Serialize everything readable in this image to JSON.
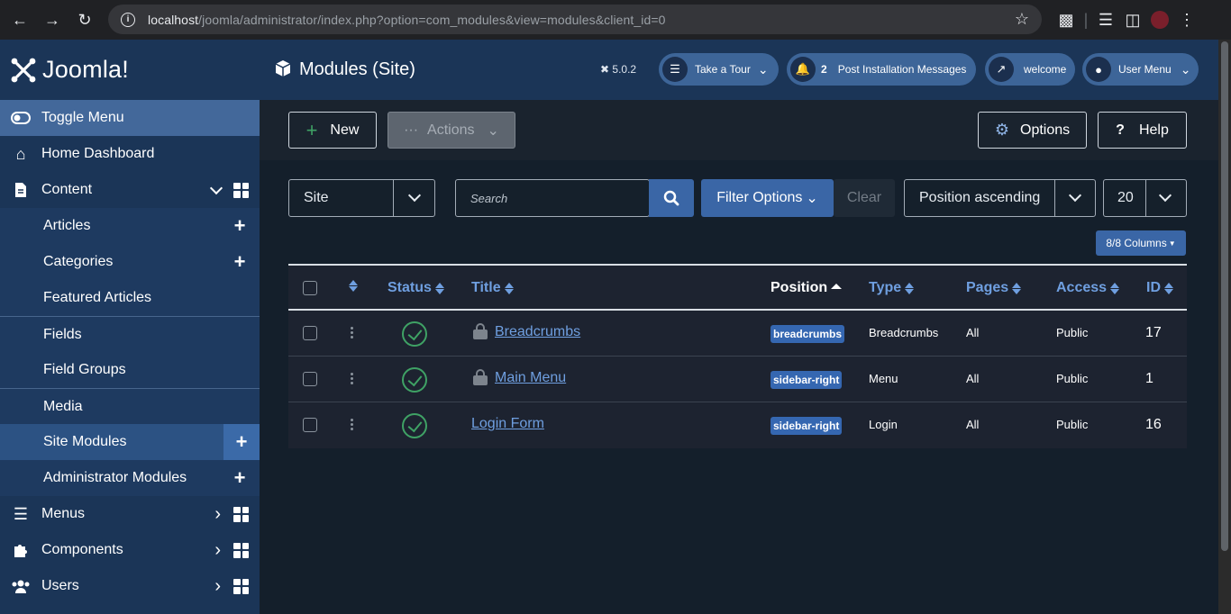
{
  "browser": {
    "url_host": "localhost",
    "url_path": "/joomla/administrator/index.php?option=com_modules&view=modules&client_id=0"
  },
  "sidebar": {
    "brand": "Joomla!",
    "toggle_label": "Toggle Menu",
    "items": [
      {
        "label": "Home Dashboard"
      },
      {
        "label": "Content"
      },
      {
        "label": "Articles"
      },
      {
        "label": "Categories"
      },
      {
        "label": "Featured Articles"
      },
      {
        "label": "Fields"
      },
      {
        "label": "Field Groups"
      },
      {
        "label": "Media"
      },
      {
        "label": "Site Modules"
      },
      {
        "label": "Administrator Modules"
      },
      {
        "label": "Menus"
      },
      {
        "label": "Components"
      },
      {
        "label": "Users"
      }
    ]
  },
  "header": {
    "title": "Modules (Site)",
    "version": "5.0.2",
    "take_tour": "Take a Tour",
    "notifications_count": "2",
    "post_install": "Post Installation Messages",
    "welcome": "welcome",
    "user_menu": "User Menu"
  },
  "toolbar": {
    "new": "New",
    "actions": "Actions",
    "options": "Options",
    "help": "Help"
  },
  "filters": {
    "client": "Site",
    "search_placeholder": "Search",
    "filter_options": "Filter Options",
    "clear": "Clear",
    "ordering": "Position ascending",
    "limit": "20",
    "columns": "8/8 Columns"
  },
  "table": {
    "headers": {
      "status": "Status",
      "title": "Title",
      "position": "Position",
      "type": "Type",
      "pages": "Pages",
      "access": "Access",
      "id": "ID"
    },
    "rows": [
      {
        "title": "Breadcrumbs",
        "locked": true,
        "position": "breadcrumbs",
        "type": "Breadcrumbs",
        "pages": "All",
        "access": "Public",
        "id": "17"
      },
      {
        "title": "Main Menu",
        "locked": true,
        "position": "sidebar-right",
        "type": "Menu",
        "pages": "All",
        "access": "Public",
        "id": "1"
      },
      {
        "title": "Login Form",
        "locked": false,
        "position": "sidebar-right",
        "type": "Login",
        "pages": "All",
        "access": "Public",
        "id": "16"
      }
    ]
  }
}
